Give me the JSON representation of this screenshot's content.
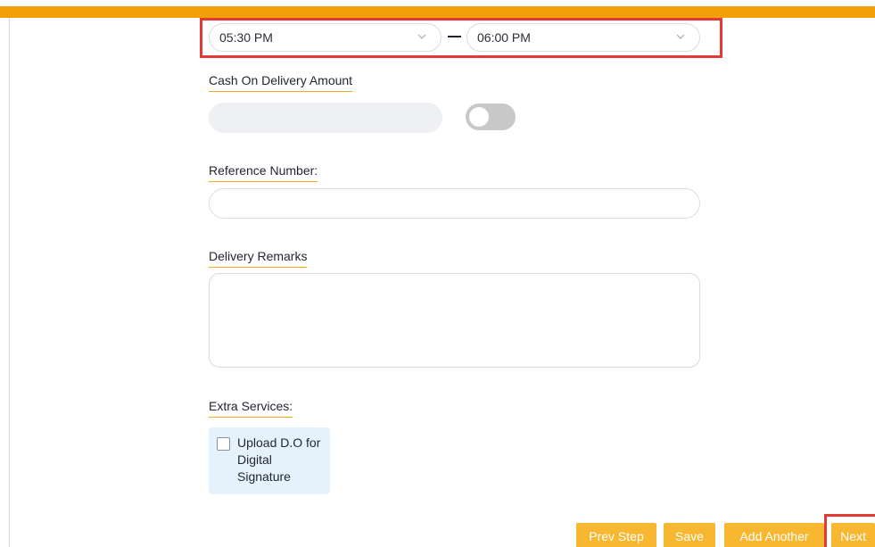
{
  "colors": {
    "top_bar": "#f49f0a",
    "button": "#f7b731",
    "highlight": "#e53935",
    "underline": "#f5a623"
  },
  "time_range": {
    "from_value": "05:30 PM",
    "to_value": "06:00 PM",
    "dropdown_icon": "chevron-down-icon"
  },
  "cod": {
    "label": "Cash On Delivery Amount",
    "value": "",
    "toggle_on": false
  },
  "reference": {
    "label": "Reference Number:",
    "value": ""
  },
  "remarks": {
    "label": "Delivery Remarks",
    "value": ""
  },
  "extra_services": {
    "label": "Extra Services:",
    "options": [
      {
        "label": "Upload D.O for Digital Signature",
        "checked": false
      }
    ]
  },
  "actions": {
    "prev_label": "Prev Step",
    "save_label": "Save",
    "add_another_label": "Add Another",
    "next_label": "Next"
  }
}
